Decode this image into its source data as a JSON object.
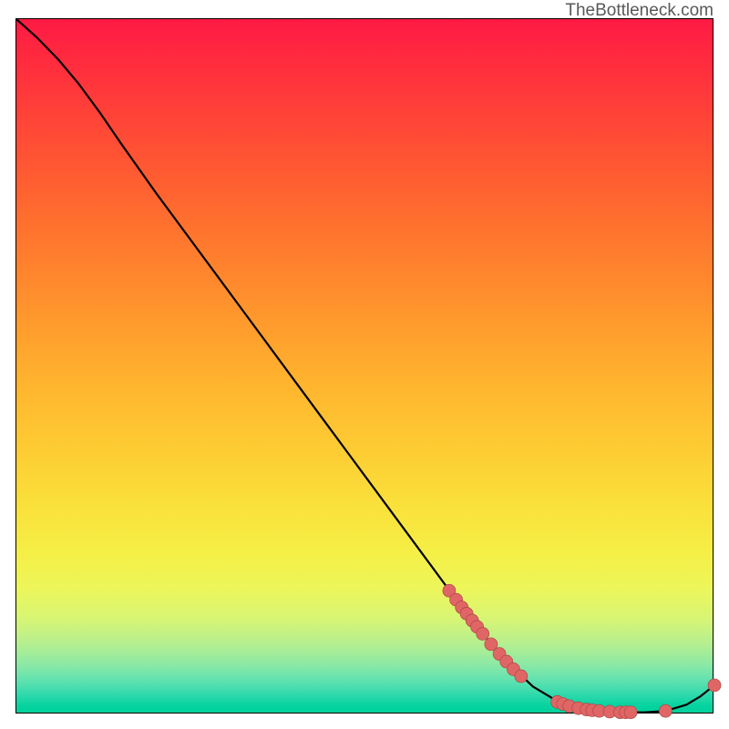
{
  "watermark": "TheBottleneck.com",
  "chart_data": {
    "type": "line",
    "title": "",
    "xlabel": "",
    "ylabel": "",
    "xlim": [
      0,
      100
    ],
    "ylim": [
      0,
      100
    ],
    "grid": false,
    "legend": false,
    "background_gradient": "rainbow_vertical",
    "series": [
      {
        "name": "bottleneck-curve",
        "x": [
          0,
          3,
          6,
          9,
          12,
          15,
          20,
          25,
          30,
          35,
          40,
          45,
          50,
          55,
          60,
          63,
          66,
          70,
          74,
          78,
          82,
          86,
          90,
          93,
          96,
          98,
          100
        ],
        "y": [
          100,
          97.3,
          94.2,
          90.6,
          86.5,
          82.1,
          75.0,
          68.2,
          61.4,
          54.6,
          47.8,
          41.0,
          34.2,
          27.4,
          20.6,
          16.5,
          12.5,
          7.8,
          4.0,
          1.6,
          0.6,
          0.3,
          0.3,
          0.5,
          1.4,
          2.6,
          4.2
        ]
      }
    ],
    "highlight_points": [
      {
        "x": 62.0,
        "y": 17.8
      },
      {
        "x": 63.0,
        "y": 16.5
      },
      {
        "x": 63.8,
        "y": 15.4
      },
      {
        "x": 64.5,
        "y": 14.5
      },
      {
        "x": 65.3,
        "y": 13.5
      },
      {
        "x": 66.0,
        "y": 12.6
      },
      {
        "x": 66.8,
        "y": 11.6
      },
      {
        "x": 68.0,
        "y": 10.1
      },
      {
        "x": 69.2,
        "y": 8.7
      },
      {
        "x": 70.2,
        "y": 7.6
      },
      {
        "x": 71.2,
        "y": 6.5
      },
      {
        "x": 72.3,
        "y": 5.5
      },
      {
        "x": 77.5,
        "y": 1.8
      },
      {
        "x": 78.3,
        "y": 1.5
      },
      {
        "x": 79.2,
        "y": 1.2
      },
      {
        "x": 80.5,
        "y": 0.9
      },
      {
        "x": 81.7,
        "y": 0.7
      },
      {
        "x": 82.5,
        "y": 0.6
      },
      {
        "x": 83.5,
        "y": 0.5
      },
      {
        "x": 85.0,
        "y": 0.4
      },
      {
        "x": 86.5,
        "y": 0.3
      },
      {
        "x": 87.3,
        "y": 0.3
      },
      {
        "x": 88.0,
        "y": 0.3
      },
      {
        "x": 93.0,
        "y": 0.5
      },
      {
        "x": 100.0,
        "y": 4.2
      }
    ],
    "dot_color": "#e06666",
    "line_color": "#000000"
  }
}
